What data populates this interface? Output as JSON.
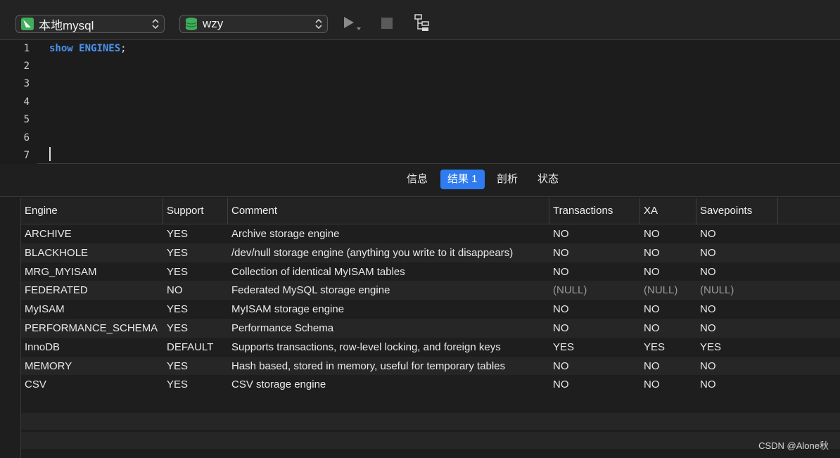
{
  "toolbar": {
    "connection": "本地mysql",
    "database": "wzy",
    "icons": [
      "mysql-connection-icon",
      "database-icon",
      "run-icon",
      "stop-icon",
      "explain-icon"
    ]
  },
  "editor": {
    "line_numbers": [
      "1",
      "2",
      "3",
      "4",
      "5",
      "6",
      "7"
    ],
    "code_keyword1": "show",
    "code_keyword2": "ENGINES",
    "code_punct": ";"
  },
  "tabs": {
    "info": "信息",
    "result1": "结果 1",
    "profile": "剖析",
    "status": "状态",
    "active": "result1"
  },
  "table": {
    "columns": [
      "Engine",
      "Support",
      "Comment",
      "Transactions",
      "XA",
      "Savepoints"
    ],
    "rows": [
      [
        "ARCHIVE",
        "YES",
        "Archive storage engine",
        "NO",
        "NO",
        "NO"
      ],
      [
        "BLACKHOLE",
        "YES",
        "/dev/null storage engine (anything you write to it disappears)",
        "NO",
        "NO",
        "NO"
      ],
      [
        "MRG_MYISAM",
        "YES",
        "Collection of identical MyISAM tables",
        "NO",
        "NO",
        "NO"
      ],
      [
        "FEDERATED",
        "NO",
        "Federated MySQL storage engine",
        "(NULL)",
        "(NULL)",
        "(NULL)"
      ],
      [
        "MyISAM",
        "YES",
        "MyISAM storage engine",
        "NO",
        "NO",
        "NO"
      ],
      [
        "PERFORMANCE_SCHEMA",
        "YES",
        "Performance Schema",
        "NO",
        "NO",
        "NO"
      ],
      [
        "InnoDB",
        "DEFAULT",
        "Supports transactions, row-level locking, and foreign keys",
        "YES",
        "YES",
        "YES"
      ],
      [
        "MEMORY",
        "YES",
        "Hash based, stored in memory, useful for temporary tables",
        "NO",
        "NO",
        "NO"
      ],
      [
        "CSV",
        "YES",
        "CSV storage engine",
        "NO",
        "NO",
        "NO"
      ]
    ]
  },
  "watermark": "CSDN @Alone秋",
  "colors": {
    "background": "#1e1e1e",
    "keyword": "#4b93ee",
    "active_tab": "#2f7bf0",
    "null_text": "#9a9a9a"
  }
}
